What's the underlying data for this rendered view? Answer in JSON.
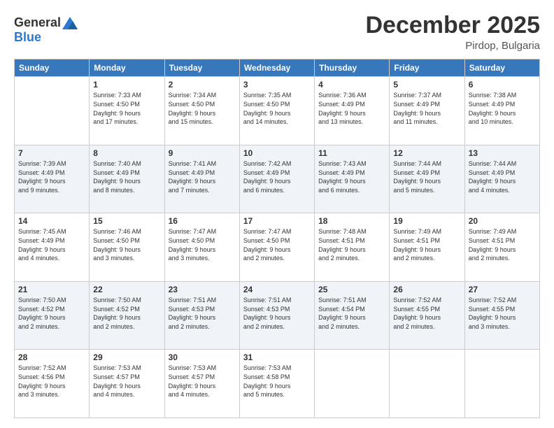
{
  "logo": {
    "general": "General",
    "blue": "Blue"
  },
  "title": "December 2025",
  "subtitle": "Pirdop, Bulgaria",
  "days": [
    "Sunday",
    "Monday",
    "Tuesday",
    "Wednesday",
    "Thursday",
    "Friday",
    "Saturday"
  ],
  "weeks": [
    [
      {
        "day": "",
        "content": ""
      },
      {
        "day": "1",
        "content": "Sunrise: 7:33 AM\nSunset: 4:50 PM\nDaylight: 9 hours\nand 17 minutes."
      },
      {
        "day": "2",
        "content": "Sunrise: 7:34 AM\nSunset: 4:50 PM\nDaylight: 9 hours\nand 15 minutes."
      },
      {
        "day": "3",
        "content": "Sunrise: 7:35 AM\nSunset: 4:50 PM\nDaylight: 9 hours\nand 14 minutes."
      },
      {
        "day": "4",
        "content": "Sunrise: 7:36 AM\nSunset: 4:49 PM\nDaylight: 9 hours\nand 13 minutes."
      },
      {
        "day": "5",
        "content": "Sunrise: 7:37 AM\nSunset: 4:49 PM\nDaylight: 9 hours\nand 11 minutes."
      },
      {
        "day": "6",
        "content": "Sunrise: 7:38 AM\nSunset: 4:49 PM\nDaylight: 9 hours\nand 10 minutes."
      }
    ],
    [
      {
        "day": "7",
        "content": "Sunrise: 7:39 AM\nSunset: 4:49 PM\nDaylight: 9 hours\nand 9 minutes."
      },
      {
        "day": "8",
        "content": "Sunrise: 7:40 AM\nSunset: 4:49 PM\nDaylight: 9 hours\nand 8 minutes."
      },
      {
        "day": "9",
        "content": "Sunrise: 7:41 AM\nSunset: 4:49 PM\nDaylight: 9 hours\nand 7 minutes."
      },
      {
        "day": "10",
        "content": "Sunrise: 7:42 AM\nSunset: 4:49 PM\nDaylight: 9 hours\nand 6 minutes."
      },
      {
        "day": "11",
        "content": "Sunrise: 7:43 AM\nSunset: 4:49 PM\nDaylight: 9 hours\nand 6 minutes."
      },
      {
        "day": "12",
        "content": "Sunrise: 7:44 AM\nSunset: 4:49 PM\nDaylight: 9 hours\nand 5 minutes."
      },
      {
        "day": "13",
        "content": "Sunrise: 7:44 AM\nSunset: 4:49 PM\nDaylight: 9 hours\nand 4 minutes."
      }
    ],
    [
      {
        "day": "14",
        "content": "Sunrise: 7:45 AM\nSunset: 4:49 PM\nDaylight: 9 hours\nand 4 minutes."
      },
      {
        "day": "15",
        "content": "Sunrise: 7:46 AM\nSunset: 4:50 PM\nDaylight: 9 hours\nand 3 minutes."
      },
      {
        "day": "16",
        "content": "Sunrise: 7:47 AM\nSunset: 4:50 PM\nDaylight: 9 hours\nand 3 minutes."
      },
      {
        "day": "17",
        "content": "Sunrise: 7:47 AM\nSunset: 4:50 PM\nDaylight: 9 hours\nand 2 minutes."
      },
      {
        "day": "18",
        "content": "Sunrise: 7:48 AM\nSunset: 4:51 PM\nDaylight: 9 hours\nand 2 minutes."
      },
      {
        "day": "19",
        "content": "Sunrise: 7:49 AM\nSunset: 4:51 PM\nDaylight: 9 hours\nand 2 minutes."
      },
      {
        "day": "20",
        "content": "Sunrise: 7:49 AM\nSunset: 4:51 PM\nDaylight: 9 hours\nand 2 minutes."
      }
    ],
    [
      {
        "day": "21",
        "content": "Sunrise: 7:50 AM\nSunset: 4:52 PM\nDaylight: 9 hours\nand 2 minutes."
      },
      {
        "day": "22",
        "content": "Sunrise: 7:50 AM\nSunset: 4:52 PM\nDaylight: 9 hours\nand 2 minutes."
      },
      {
        "day": "23",
        "content": "Sunrise: 7:51 AM\nSunset: 4:53 PM\nDaylight: 9 hours\nand 2 minutes."
      },
      {
        "day": "24",
        "content": "Sunrise: 7:51 AM\nSunset: 4:53 PM\nDaylight: 9 hours\nand 2 minutes."
      },
      {
        "day": "25",
        "content": "Sunrise: 7:51 AM\nSunset: 4:54 PM\nDaylight: 9 hours\nand 2 minutes."
      },
      {
        "day": "26",
        "content": "Sunrise: 7:52 AM\nSunset: 4:55 PM\nDaylight: 9 hours\nand 2 minutes."
      },
      {
        "day": "27",
        "content": "Sunrise: 7:52 AM\nSunset: 4:55 PM\nDaylight: 9 hours\nand 3 minutes."
      }
    ],
    [
      {
        "day": "28",
        "content": "Sunrise: 7:52 AM\nSunset: 4:56 PM\nDaylight: 9 hours\nand 3 minutes."
      },
      {
        "day": "29",
        "content": "Sunrise: 7:53 AM\nSunset: 4:57 PM\nDaylight: 9 hours\nand 4 minutes."
      },
      {
        "day": "30",
        "content": "Sunrise: 7:53 AM\nSunset: 4:57 PM\nDaylight: 9 hours\nand 4 minutes."
      },
      {
        "day": "31",
        "content": "Sunrise: 7:53 AM\nSunset: 4:58 PM\nDaylight: 9 hours\nand 5 minutes."
      },
      {
        "day": "",
        "content": ""
      },
      {
        "day": "",
        "content": ""
      },
      {
        "day": "",
        "content": ""
      }
    ]
  ]
}
